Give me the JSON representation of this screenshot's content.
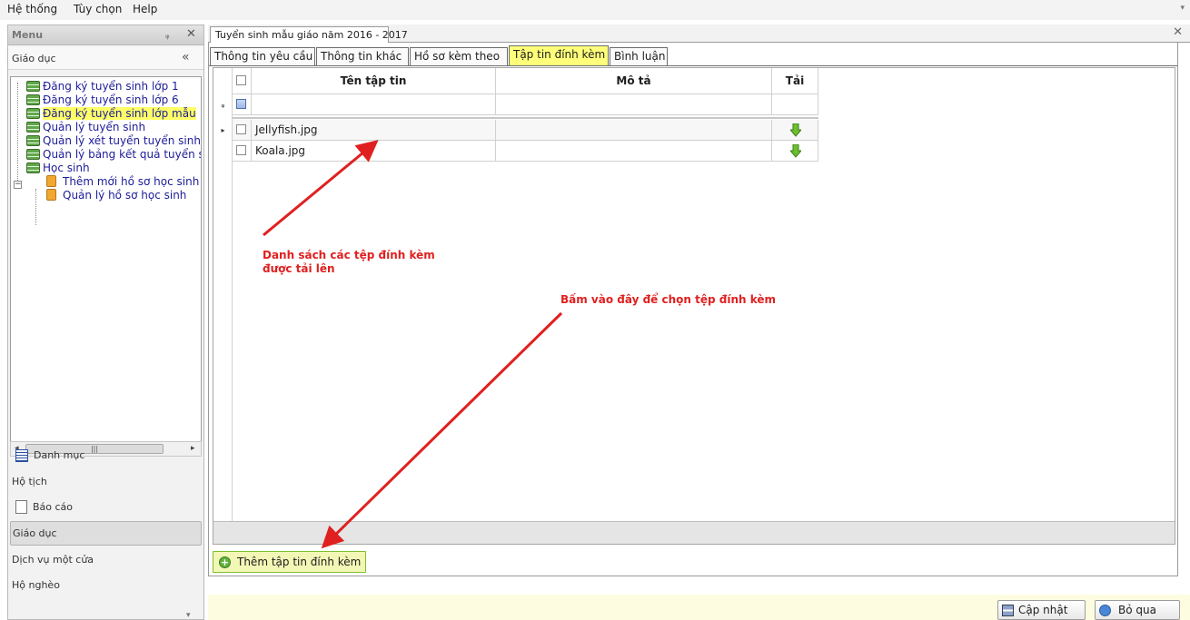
{
  "menubar": {
    "items": [
      "Hệ thống",
      "Tùy chọn",
      "Help"
    ]
  },
  "left_panel": {
    "title": "Menu",
    "group_title": "Giáo dục",
    "tree_items": [
      {
        "label": "Đăng ký tuyển sinh lớp 1",
        "icon": "list-icon"
      },
      {
        "label": "Đăng ký tuyển sinh lớp 6",
        "icon": "list-icon"
      },
      {
        "label": "Đăng ký tuyển sinh lớp mẫu",
        "icon": "list-icon",
        "selected": true
      },
      {
        "label": "Quản lý tuyển sinh",
        "icon": "list-icon"
      },
      {
        "label": "Quản lý xét tuyển tuyển sinh",
        "icon": "list-icon"
      },
      {
        "label": "Quản lý bảng kết quả tuyển s",
        "icon": "list-icon"
      },
      {
        "label": "Học sinh",
        "icon": "list-icon",
        "expanded": true
      },
      {
        "label": "Thêm mới hồ sơ học sinh",
        "icon": "document-icon",
        "child": true
      },
      {
        "label": "Quản lý hồ sơ học sinh",
        "icon": "document-icon",
        "child": true
      }
    ],
    "nav_items": [
      {
        "label": "Danh mục",
        "icon": "list-icon"
      },
      {
        "label": "Hộ tịch"
      },
      {
        "label": "Báo cáo",
        "icon": "report-icon"
      },
      {
        "label": "Giáo dục",
        "active": true
      },
      {
        "label": "Dịch vụ một cửa"
      },
      {
        "label": "Hộ nghèo"
      }
    ]
  },
  "document_tab": {
    "title": "Tuyển sinh mẫu giáo năm 2016 - 2017"
  },
  "tabs": [
    "Thông tin yêu cầu",
    "Thông tin khác",
    "Hồ sơ kèm theo",
    "Tập tin đính kèm",
    "Bình luận"
  ],
  "active_tab": "Tập tin đính kèm",
  "grid": {
    "columns": [
      "Tên tập tin",
      "Mô tả",
      "Tải"
    ],
    "rows": [
      {
        "file_name": "Jellyfish.jpg",
        "description": ""
      },
      {
        "file_name": "Koala.jpg",
        "description": ""
      }
    ]
  },
  "add_button_label": "Thêm tập tin đính kèm",
  "footer": {
    "save_label": "Cập nhật",
    "cancel_label": "Bỏ qua"
  },
  "annotations": {
    "list_note_line1": "Danh sách các tệp đính kèm",
    "list_note_line2": "được tải lên",
    "click_note": "Bấm vào đây để chọn tệp đính kèm"
  },
  "colors": {
    "active_tab": "#ffff7a",
    "annotation": "#e02020",
    "add_button_bg": "#f3f7b6",
    "selected_tree_item": "#ffff66"
  }
}
